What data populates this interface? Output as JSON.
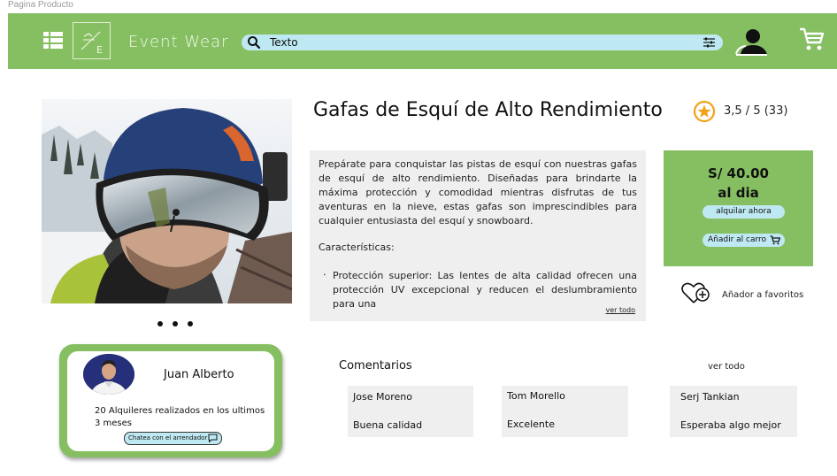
{
  "frame": {
    "label": "Pagina Producto"
  },
  "header": {
    "brand": "Event Wear",
    "search": {
      "value": "Texto",
      "placeholder": "Texto"
    },
    "icons": [
      "menu-grid-icon",
      "logo-icon",
      "search-icon",
      "filter-sliders-icon",
      "user-account-icon",
      "shopping-cart-icon"
    ]
  },
  "product": {
    "title": "Gafas de Esquí de Alto Rendimiento",
    "rating_text": "3,5 / 5 (33)",
    "rating": 3.5,
    "rating_max": 5,
    "rating_count": 33,
    "description": {
      "intro": "Prepárate para conquistar las pistas de esquí con nuestras gafas de esquí de alto rendimiento. Diseñadas para brindarte la máxima protección y comodidad mientras disfrutas de tus aventuras en la nieve, estas gafas son imprescindibles para cualquier entusiasta del esquí y snowboard.",
      "features_heading": "Características:",
      "features": [
        "Protección superior: Las lentes de alta calidad ofrecen una protección UV excepcional y reducen el deslumbramiento para una"
      ],
      "more_label": "ver todo"
    },
    "image_count": 3
  },
  "pricing": {
    "price": "S/ 40.00",
    "per": "al dia",
    "rent_label": "alquilar ahora",
    "add_cart_label": "Añadir al carro"
  },
  "favorites": {
    "label": "Añador a favoritos"
  },
  "seller": {
    "name": "Juan Alberto",
    "info": "20 Alquileres realizados en los ultimos 3 meses",
    "chat_label": "Chatea con el arrendador"
  },
  "comments": {
    "title": "Comentarios",
    "see_all": "ver todo",
    "items": [
      {
        "name": "Jose Moreno",
        "text": "Buena calidad"
      },
      {
        "name": "Tom Morello",
        "text": "Excelente"
      },
      {
        "name": "Serj Tankian",
        "text": "Esperaba algo mejor"
      }
    ]
  },
  "colors": {
    "brand_green": "#86bf62",
    "accent_blue": "#bfe9f2",
    "panel_gray": "#efefef",
    "star_orange": "#f0a21b"
  }
}
